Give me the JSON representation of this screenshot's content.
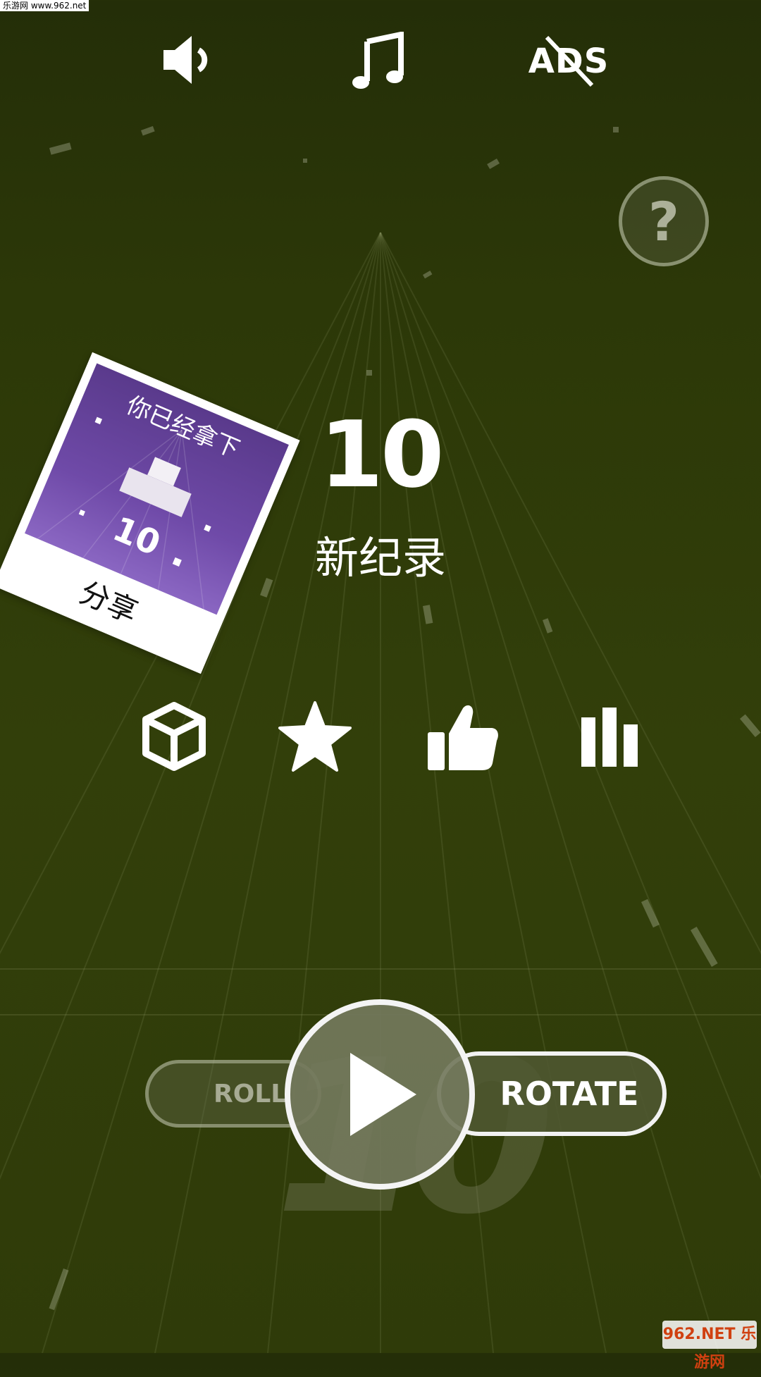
{
  "watermark_top_left": "乐游网 www.962.net",
  "watermark_bottom_right": "962.NET 乐游网",
  "top_bar": {
    "sound_icon": "speaker-icon",
    "music_icon": "music-note-icon",
    "ads_label": "ADS"
  },
  "help_label": "?",
  "score": "10",
  "record_label": "新纪录",
  "share_card": {
    "title": "你已经拿下",
    "score": "10",
    "share_label": "分享",
    "background_color": "#6a45a0"
  },
  "actions": [
    {
      "icon": "cube-icon"
    },
    {
      "icon": "star-icon"
    },
    {
      "icon": "thumbs-up-icon"
    },
    {
      "icon": "leaderboard-icon"
    }
  ],
  "mode": {
    "roll_label": "ROLL",
    "rotate_label": "ROTATE",
    "selected": "ROTATE"
  },
  "background_number": "10",
  "colors": {
    "background": "#2f3b09",
    "foreground": "#ffffff"
  }
}
